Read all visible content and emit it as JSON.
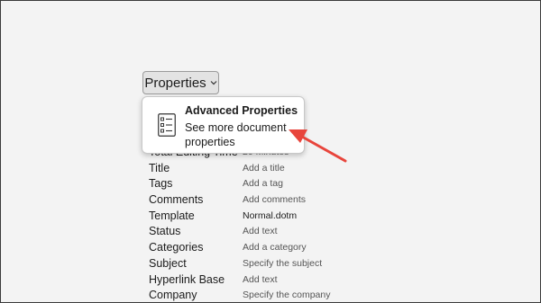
{
  "properties_button": {
    "label": "Properties",
    "chevron_icon": "chevron-down-icon"
  },
  "dropdown": {
    "icon": "list-icon",
    "title": "Advanced Properties",
    "description": "See more document properties"
  },
  "properties": [
    {
      "label": "Total Editing Time",
      "value": "20 Minutes"
    },
    {
      "label": "Title",
      "value": "Add a title"
    },
    {
      "label": "Tags",
      "value": "Add a tag"
    },
    {
      "label": "Comments",
      "value": "Add comments"
    },
    {
      "label": "Template",
      "value": "Normal.dotm"
    },
    {
      "label": "Status",
      "value": "Add text"
    },
    {
      "label": "Categories",
      "value": "Add a category"
    },
    {
      "label": "Subject",
      "value": "Specify the subject"
    },
    {
      "label": "Hyperlink Base",
      "value": "Add text"
    },
    {
      "label": "Company",
      "value": "Specify the company"
    }
  ],
  "colors": {
    "background": "#f3f3f3",
    "arrow": "#e8453c",
    "button": "#e3e3e3"
  }
}
